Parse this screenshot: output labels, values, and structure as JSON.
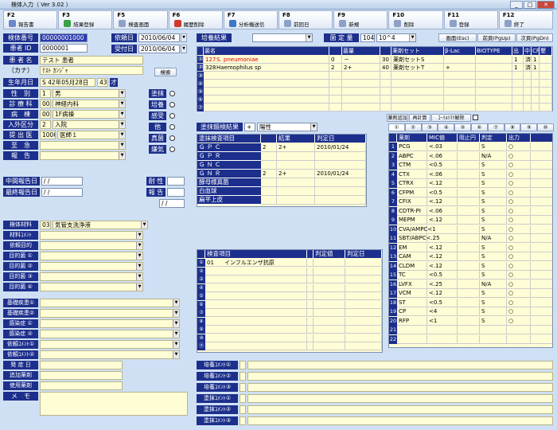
{
  "window": {
    "title": "検体入力（ Ver 3.02 ）"
  },
  "fkeys": [
    {
      "key": "F2",
      "label": "報告書",
      "color": "#6a88c8"
    },
    {
      "key": "F3",
      "label": "結果登録",
      "color": "#3aa046"
    },
    {
      "key": "F5",
      "label": "検査画面",
      "color": "#8da0c8"
    },
    {
      "key": "F6",
      "label": "履歴削除",
      "color": "#d03a2a"
    },
    {
      "key": "F7",
      "label": "分析機送信",
      "color": "#3a78c8"
    },
    {
      "key": "F8",
      "label": "前回日",
      "color": "#8da0c8"
    },
    {
      "key": "F9",
      "label": "新規",
      "color": "#8da0c8"
    },
    {
      "key": "F10",
      "label": "削除",
      "color": "#8da0c8"
    },
    {
      "key": "F11",
      "label": "登録",
      "color": "#8da0c8"
    },
    {
      "key": "F12",
      "label": "終了",
      "color": "#8da0c8"
    }
  ],
  "left": {
    "specimen_no_label": "検体番号",
    "specimen_no": "00000001000",
    "patient_id_label": "患者 ID",
    "patient_id": "0000001",
    "name_label": "患 者 名",
    "name": "テスト 患者",
    "kana_label": "（カナ）",
    "kana": "ﾃｽﾄ ｶﾝｼﾞｬ",
    "search_button": "検索",
    "birth_label": "生年月日",
    "birth": "S 42年05月28日",
    "age": "43",
    "age_unit": "才",
    "sex_label": "性　別",
    "sex_code": "1",
    "sex": "男",
    "dept_label": "診 療 科",
    "dept_code": "003",
    "dept": "神経内科",
    "ward_label": "病　棟",
    "ward_code": "001",
    "ward": "1F病棟",
    "inout_label": "入外区分",
    "inout_code": "2",
    "inout": "入院",
    "doctor_label": "提 出 医",
    "doctor_code": "1000",
    "doctor": "医師１",
    "urgent_label": "至　急",
    "report_label": "報　告"
  },
  "dates": {
    "request_label": "依頼日",
    "request": "2010/06/04",
    "receive_label": "受付日",
    "receive": "2010/06/04"
  },
  "checks": [
    {
      "label": "塗抹"
    },
    {
      "label": "培養"
    },
    {
      "label": "感受"
    },
    {
      "label": "他"
    },
    {
      "label": "真菌"
    },
    {
      "label": "嫌気"
    }
  ],
  "midreport": {
    "mid_label": "中間報告日",
    "mid": "/  /",
    "final_label": "最終報告日",
    "final": "/  /",
    "sense_label": "耐 性",
    "dilute_label": "報 告",
    "date": "/  /"
  },
  "specimen": {
    "material_label": "検体材料",
    "material_code": "03",
    "material": "気管支洗浄液",
    "comment_label": "材料ｺﾒﾝﾄ",
    "purpose_label": "依頼目的",
    "purpose1": "目的菌 ①",
    "purpose2": "目的菌 ②",
    "purpose3": "目的菌 ③",
    "purpose4": "目的菌 ④",
    "disease1": "基礎疾患①",
    "disease2": "基礎疾患②",
    "sx1": "感染症 ①",
    "sx2": "感染症 ②",
    "req_comment1": "依頼ｺﾒﾝﾄ①",
    "req_comment2": "依頼ｺﾒﾝﾄ②",
    "onset_label": "発 症 日",
    "antibiotic_label": "追加薬剤",
    "used_drug_label": "使用薬剤",
    "memo_label": "メ　モ"
  },
  "main_table": {
    "judge_label": "培養結果",
    "amount_label": "菌 定 量",
    "amount_code": "104",
    "amount": "10^4",
    "screen_btn": "画面(Esc)",
    "page_up": "前頁(PgUp)",
    "page_down": "次頁(PgDn)",
    "headers": [
      "菌名",
      "",
      "菌量",
      "",
      "薬剤セット",
      "β-Lac",
      "BIOTYPE",
      "",
      ""
    ],
    "rows": [
      {
        "no": "127",
        "name": "S. pneumoniae",
        "qty": "0",
        "qty2": "－",
        "set_no": "30",
        "set": "薬剤セットS",
        "beta": "",
        "bio": "",
        "c1": "1",
        "c2": "済",
        "c3": "1"
      },
      {
        "no": "328",
        "name": "Haemophilus sp",
        "qty": "2",
        "qty2": "2+",
        "set_no": "40",
        "set": "薬剤セットT",
        "beta": "+",
        "bio": "",
        "c1": "1",
        "c2": "済",
        "c3": "1"
      }
    ]
  },
  "smear": {
    "title": "塗抹鏡検結果",
    "title_code": "+",
    "title_val": "陽性",
    "headers": [
      "塗抹検査項目",
      "",
      "結果",
      "判定日"
    ],
    "rows": [
      {
        "item": "Ｇ Ｐ Ｃ",
        "code": "2",
        "result": "2+",
        "date": "2010/01/24"
      },
      {
        "item": "Ｇ Ｐ Ｒ",
        "code": "",
        "result": "",
        "date": ""
      },
      {
        "item": "Ｇ Ｎ Ｃ",
        "code": "",
        "result": "",
        "date": ""
      },
      {
        "item": "Ｇ Ｎ Ｒ",
        "code": "2",
        "result": "2+",
        "date": "2010/01/24"
      },
      {
        "item": "酵母様真菌",
        "code": "",
        "result": "",
        "date": ""
      },
      {
        "item": "白血球",
        "code": "",
        "result": "",
        "date": ""
      },
      {
        "item": "扁平上皮",
        "code": "",
        "result": "",
        "date": ""
      }
    ]
  },
  "ag": {
    "headers": [
      "",
      "検査項目",
      "",
      "判定値",
      "判定日"
    ],
    "rows": [
      {
        "no": "01",
        "item": "インフルエンザ抗原",
        "val": "",
        "date": ""
      }
    ]
  },
  "sens": {
    "buttons": [
      "薬剤追加",
      "再計算",
      "ｺｰﾘﾙﾂﾏﾘ解除"
    ],
    "tabs": [
      "①",
      "②",
      "③",
      "④",
      "⑤",
      "⑥",
      "⑦",
      "⑧",
      "⑨",
      "⑩"
    ],
    "headers": [
      "",
      "薬剤",
      "MIC値",
      "阻止円",
      "判定",
      "出力"
    ],
    "rows": [
      {
        "n": "1",
        "drug": "PCG",
        "mic": "<.03",
        "zone": "",
        "judge": "S",
        "out": "○"
      },
      {
        "n": "2",
        "drug": "ABPC",
        "mic": "<.06",
        "zone": "",
        "judge": "N/A",
        "out": "○"
      },
      {
        "n": "3",
        "drug": "CTM",
        "mic": "<0.5",
        "zone": "",
        "judge": "S",
        "out": "○"
      },
      {
        "n": "4",
        "drug": "CTX",
        "mic": "<.06",
        "zone": "",
        "judge": "S",
        "out": "○"
      },
      {
        "n": "5",
        "drug": "CTRX",
        "mic": "<.12",
        "zone": "",
        "judge": "S",
        "out": "○"
      },
      {
        "n": "6",
        "drug": "CFPM",
        "mic": "<0.5",
        "zone": "",
        "judge": "S",
        "out": "○"
      },
      {
        "n": "7",
        "drug": "CFIX",
        "mic": "<.12",
        "zone": "",
        "judge": "S",
        "out": "○"
      },
      {
        "n": "8",
        "drug": "CDTR-PI",
        "mic": "<.06",
        "zone": "",
        "judge": "S",
        "out": "○"
      },
      {
        "n": "9",
        "drug": "MEPM",
        "mic": "<.12",
        "zone": "",
        "judge": "S",
        "out": "○"
      },
      {
        "n": "10",
        "drug": "CVA/AMPC<1",
        "mic": "",
        "zone": "",
        "judge": "S",
        "out": "○"
      },
      {
        "n": "11",
        "drug": "SBT/ABPC<.25",
        "mic": "",
        "zone": "",
        "judge": "N/A",
        "out": "○"
      },
      {
        "n": "12",
        "drug": "EM",
        "mic": "<.12",
        "zone": "",
        "judge": "S",
        "out": "○"
      },
      {
        "n": "13",
        "drug": "CAM",
        "mic": "<.12",
        "zone": "",
        "judge": "S",
        "out": "○"
      },
      {
        "n": "14",
        "drug": "CLDM",
        "mic": "<.12",
        "zone": "",
        "judge": "S",
        "out": "○"
      },
      {
        "n": "15",
        "drug": "TC",
        "mic": "<0.5",
        "zone": "",
        "judge": "S",
        "out": "○"
      },
      {
        "n": "16",
        "drug": "LVFX",
        "mic": "<.25",
        "zone": "",
        "judge": "N/A",
        "out": "○"
      },
      {
        "n": "17",
        "drug": "VCM",
        "mic": "<.12",
        "zone": "",
        "judge": "S",
        "out": "○"
      },
      {
        "n": "18",
        "drug": "ST",
        "mic": "<0.5",
        "zone": "",
        "judge": "S",
        "out": "○"
      },
      {
        "n": "19",
        "drug": "CP",
        "mic": "<4",
        "zone": "",
        "judge": "S",
        "out": "○"
      },
      {
        "n": "20",
        "drug": "RFP",
        "mic": "<1",
        "zone": "",
        "judge": "S",
        "out": "○"
      },
      {
        "n": "21",
        "drug": "",
        "mic": "",
        "zone": "",
        "judge": "",
        "out": ""
      },
      {
        "n": "22",
        "drug": "",
        "mic": "",
        "zone": "",
        "judge": "",
        "out": ""
      }
    ]
  },
  "comments": [
    {
      "label": "培養ｺﾒﾝﾄ①"
    },
    {
      "label": "培養ｺﾒﾝﾄ②"
    },
    {
      "label": "培養ｺﾒﾝﾄ③"
    },
    {
      "label": "塗抹ｺﾒﾝﾄ①"
    },
    {
      "label": "塗抹ｺﾒﾝﾄ②"
    },
    {
      "label": "塗抹ｺﾒﾝﾄ③"
    }
  ]
}
